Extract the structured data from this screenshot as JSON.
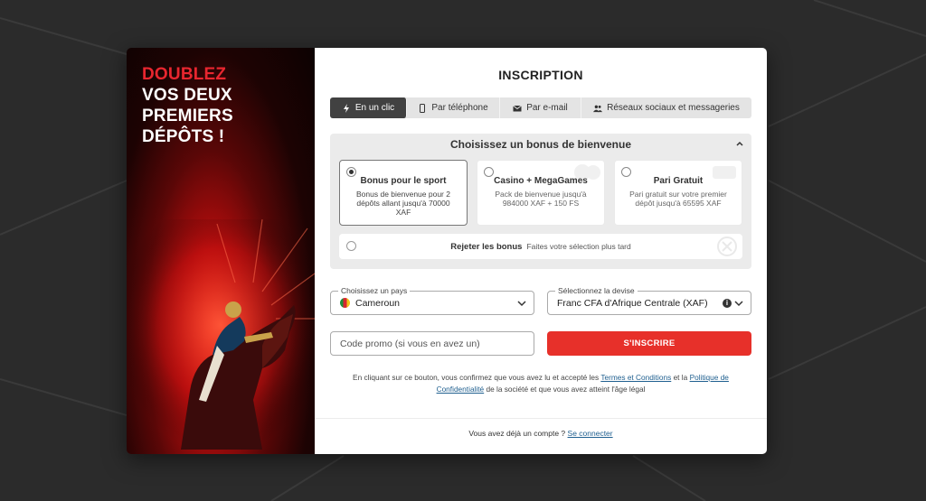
{
  "promo": {
    "line1": "DOUBLEZ",
    "line2": "VOS DEUX",
    "line3": "PREMIERS",
    "line4": "DÉPÔTS !"
  },
  "form": {
    "title": "INSCRIPTION",
    "tabs": [
      {
        "label": "En un clic",
        "icon": "lightning-icon",
        "active": true
      },
      {
        "label": "Par téléphone",
        "icon": "phone-icon",
        "active": false
      },
      {
        "label": "Par e-mail",
        "icon": "envelope-icon",
        "active": false
      },
      {
        "label": "Réseaux sociaux et messageries",
        "icon": "users-icon",
        "active": false
      }
    ],
    "bonus": {
      "heading": "Choisissez un bonus de bienvenue",
      "options": [
        {
          "title": "Bonus pour le sport",
          "desc": "Bonus de bienvenue pour 2 dépôts allant jusqu'à 70000 XAF",
          "selected": true
        },
        {
          "title": "Casino + MegaGames",
          "desc": "Pack de bienvenue jusqu'à 984000 XAF + 150 FS",
          "selected": false
        },
        {
          "title": "Pari Gratuit",
          "desc": "Pari gratuit sur votre premier dépôt jusqu'à 65595 XAF",
          "selected": false
        }
      ],
      "reject_label": "Rejeter les bonus",
      "reject_hint": "Faites votre sélection plus tard"
    },
    "country": {
      "label": "Choisissez un pays",
      "value": "Cameroun"
    },
    "currency": {
      "label": "Sélectionnez la devise",
      "value": "Franc CFA d'Afrique Centrale (XAF)"
    },
    "promo_code": {
      "placeholder": "Code promo (si vous en avez un)"
    },
    "submit_label": "S'INSCRIRE",
    "legal": {
      "part1": "En cliquant sur ce bouton, vous confirmez que vous avez lu et accepté les",
      "link1": "Termes et Conditions",
      "part2": "et la",
      "link2": "Politique de Confidentialité",
      "part3": "de la société et que vous avez atteint l'âge légal"
    },
    "footer": {
      "text": "Vous avez déjà un compte ?",
      "link": "Se connecter"
    }
  },
  "colors": {
    "accent": "#e7302a",
    "promo_red": "#e8262f",
    "tab_active": "#414141",
    "background": "#2b2b2b"
  }
}
